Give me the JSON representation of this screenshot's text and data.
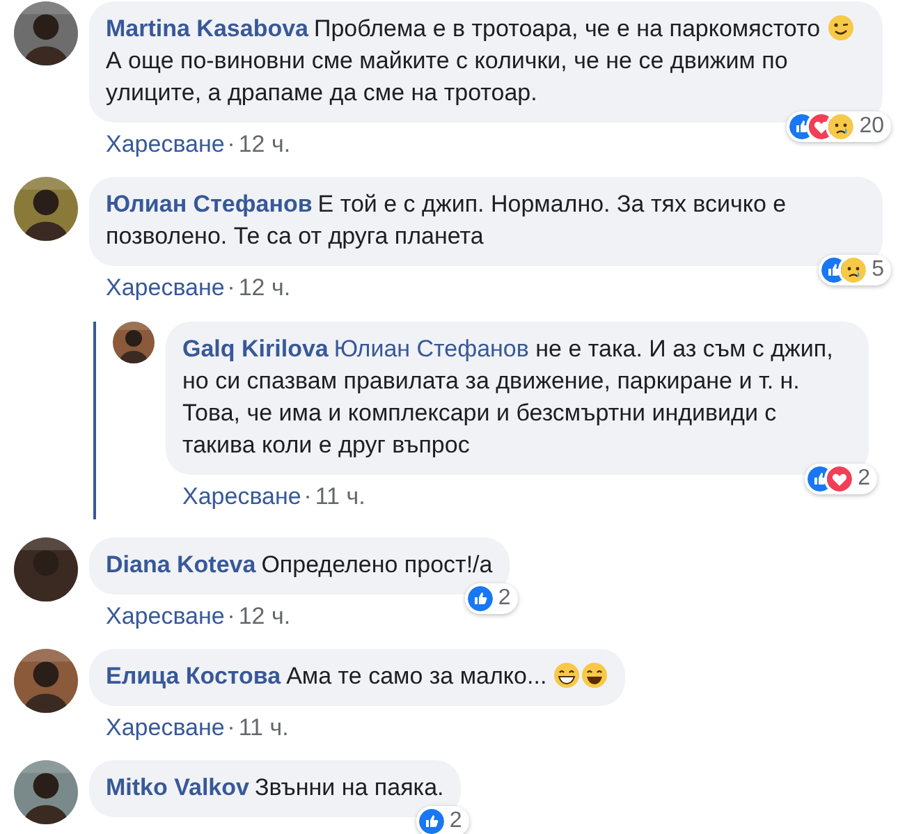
{
  "comments": [
    {
      "author": "Martina Kasabova",
      "parts": [
        {
          "kind": "text",
          "text": "Проблема е в тротоара, че е на паркомястото "
        },
        {
          "kind": "wink"
        },
        {
          "kind": "text",
          "text": " А още по-виновни сме майките с колички, че не се движим по улиците, а драпаме да сме на тротоар."
        }
      ],
      "reactions": [
        {
          "kind": "like"
        },
        {
          "kind": "love"
        },
        {
          "kind": "sad"
        }
      ],
      "count": "20",
      "like": "Харесване",
      "time": "12 ч."
    },
    {
      "author": "Юлиан Стефанов",
      "parts": [
        {
          "kind": "text",
          "text": "Е той е с джип. Нормално. За тях всичко е позволено. Те са от друга планета"
        }
      ],
      "reactions": [
        {
          "kind": "like"
        },
        {
          "kind": "sad"
        }
      ],
      "count": "5",
      "like": "Харесване",
      "time": "12 ч.",
      "replies": [
        {
          "author": "Galq Kirilova",
          "parts": [
            {
              "kind": "mention",
              "text": "Юлиан Стефанов"
            },
            {
              "kind": "text",
              "text": " не е така. И аз съм с джип, но си спазвам правилата за движение, паркиране и т. н. Това, че има и комплексари и безсмъртни индивиди с такива коли е друг въпрос"
            }
          ],
          "reactions": [
            {
              "kind": "like"
            },
            {
              "kind": "love"
            }
          ],
          "count": "2",
          "like": "Харесване",
          "time": "11 ч."
        }
      ]
    },
    {
      "author": "Diana Koteva",
      "parts": [
        {
          "kind": "text",
          "text": "Определено прост!/а"
        }
      ],
      "reactions": [
        {
          "kind": "like"
        }
      ],
      "count": "2",
      "like": "Харесване",
      "time": "12 ч."
    },
    {
      "author": "Елица Костова",
      "parts": [
        {
          "kind": "text",
          "text": "Ама те само за малко... "
        },
        {
          "kind": "grin"
        },
        {
          "kind": "smile"
        }
      ],
      "like": "Харесване",
      "time": "11 ч."
    },
    {
      "author": "Mitko Valkov",
      "parts": [
        {
          "kind": "text",
          "text": "Звънни на паяка."
        }
      ],
      "reactions": [
        {
          "kind": "like"
        }
      ],
      "count": "2"
    }
  ]
}
